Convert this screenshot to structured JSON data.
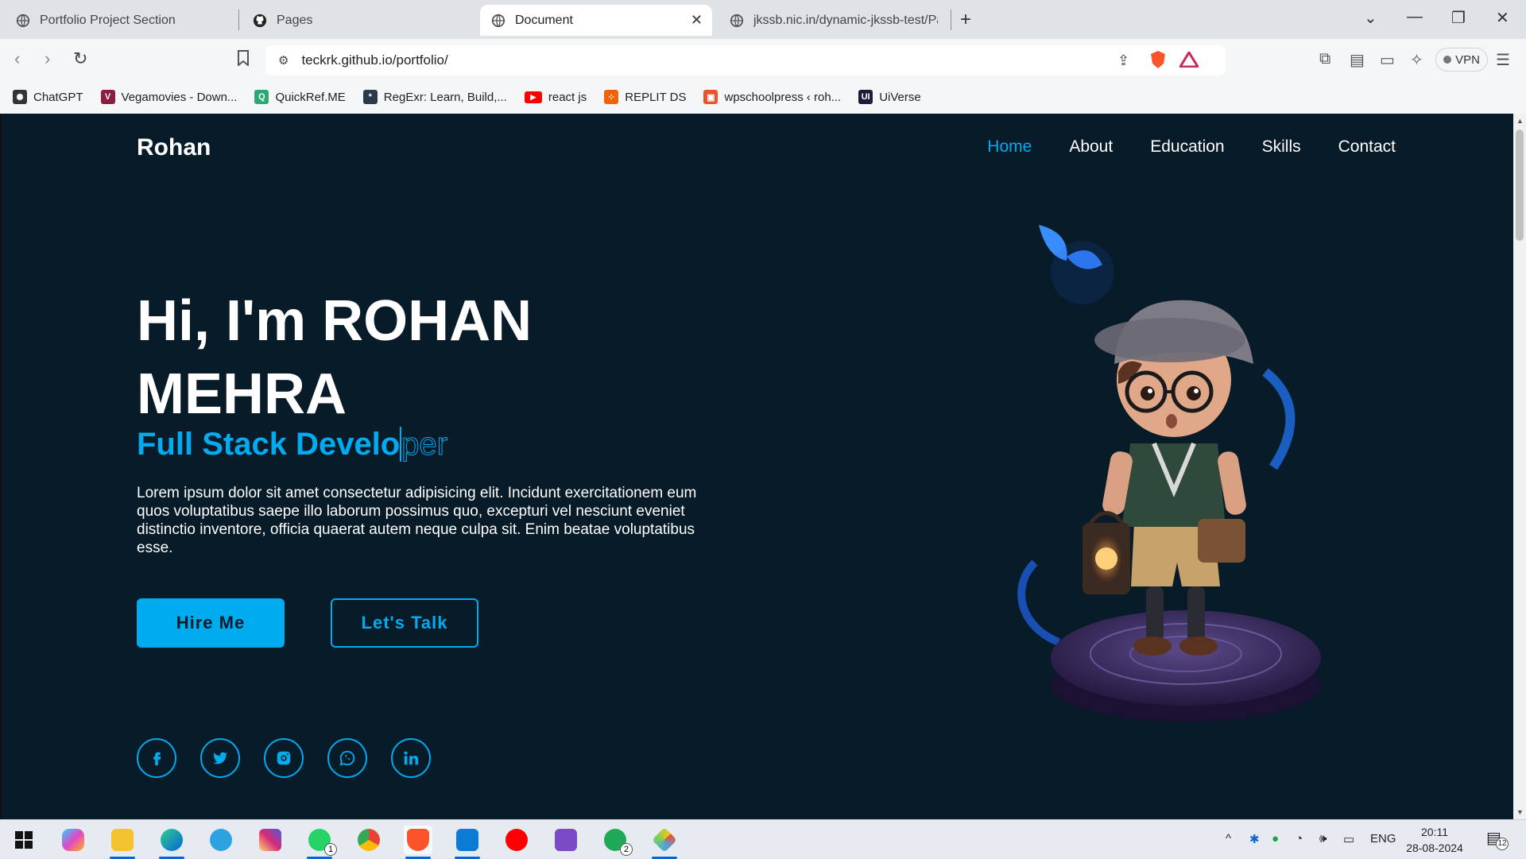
{
  "browser": {
    "tabs": [
      {
        "title": "Portfolio Project Section",
        "icon": "globe-icon",
        "active": false
      },
      {
        "title": "Pages",
        "icon": "github-icon",
        "active": false
      },
      {
        "title": "Document",
        "icon": "globe-icon",
        "active": true
      },
      {
        "title": "jkssb.nic.in/dynamic-jkssb-test/Page",
        "icon": "globe-icon",
        "active": false
      }
    ],
    "new_tab": "+",
    "url": "teckrk.github.io/portfolio/",
    "vpn_label": "VPN",
    "bookmarks": [
      {
        "label": "ChatGPT",
        "icon": "chatgpt-icon",
        "color": "#333333"
      },
      {
        "label": "Vegamovies - Down...",
        "icon": "vegamovies-icon",
        "color": "#8b1e3f"
      },
      {
        "label": "QuickRef.ME",
        "icon": "quickref-icon",
        "color": "#2aa876"
      },
      {
        "label": "RegExr: Learn, Build,...",
        "icon": "regexr-icon",
        "color": "#2b3a4a"
      },
      {
        "label": "react js",
        "icon": "youtube-icon",
        "color": "#ff0000"
      },
      {
        "label": "REPLIT DS",
        "icon": "replit-icon",
        "color": "#f26207"
      },
      {
        "label": "wpschoolpress ‹ roh...",
        "icon": "wpschoolpress-icon",
        "color": "#e8542c"
      },
      {
        "label": "UiVerse",
        "icon": "uiverse-icon",
        "color": "#1d1a3a"
      }
    ]
  },
  "page": {
    "logo": "Rohan",
    "nav": [
      {
        "label": "Home",
        "active": true
      },
      {
        "label": "About",
        "active": false
      },
      {
        "label": "Education",
        "active": false
      },
      {
        "label": "Skills",
        "active": false
      },
      {
        "label": "Contact",
        "active": false
      }
    ],
    "hero": {
      "title": "Hi, I'm ROHAN MEHRA",
      "subtitle_typed": "Full Stack Develo",
      "subtitle_rest": "per",
      "text": "Lorem ipsum dolor sit amet consectetur adipisicing elit. Incidunt exercitationem eum quos voluptatibus saepe illo laborum possimus quo, excepturi vel nesciunt eveniet distinctio inventore, officia quaerat autem neque culpa sit. Enim beatae voluptatibus esse.",
      "primary_button": "Hire Me",
      "secondary_button": "Let's Talk"
    },
    "socials": [
      "facebook-icon",
      "twitter-icon",
      "instagram-icon",
      "whatsapp-icon",
      "linkedin-icon"
    ],
    "colors": {
      "background": "#081b29",
      "accent": "#00abf0",
      "text": "#ffffff"
    }
  },
  "taskbar": {
    "language": "ENG",
    "time": "20:11",
    "date": "28-08-2024",
    "notification_count": "12",
    "whatsapp_badge_1": "1",
    "whatsapp_badge_2": "2"
  }
}
